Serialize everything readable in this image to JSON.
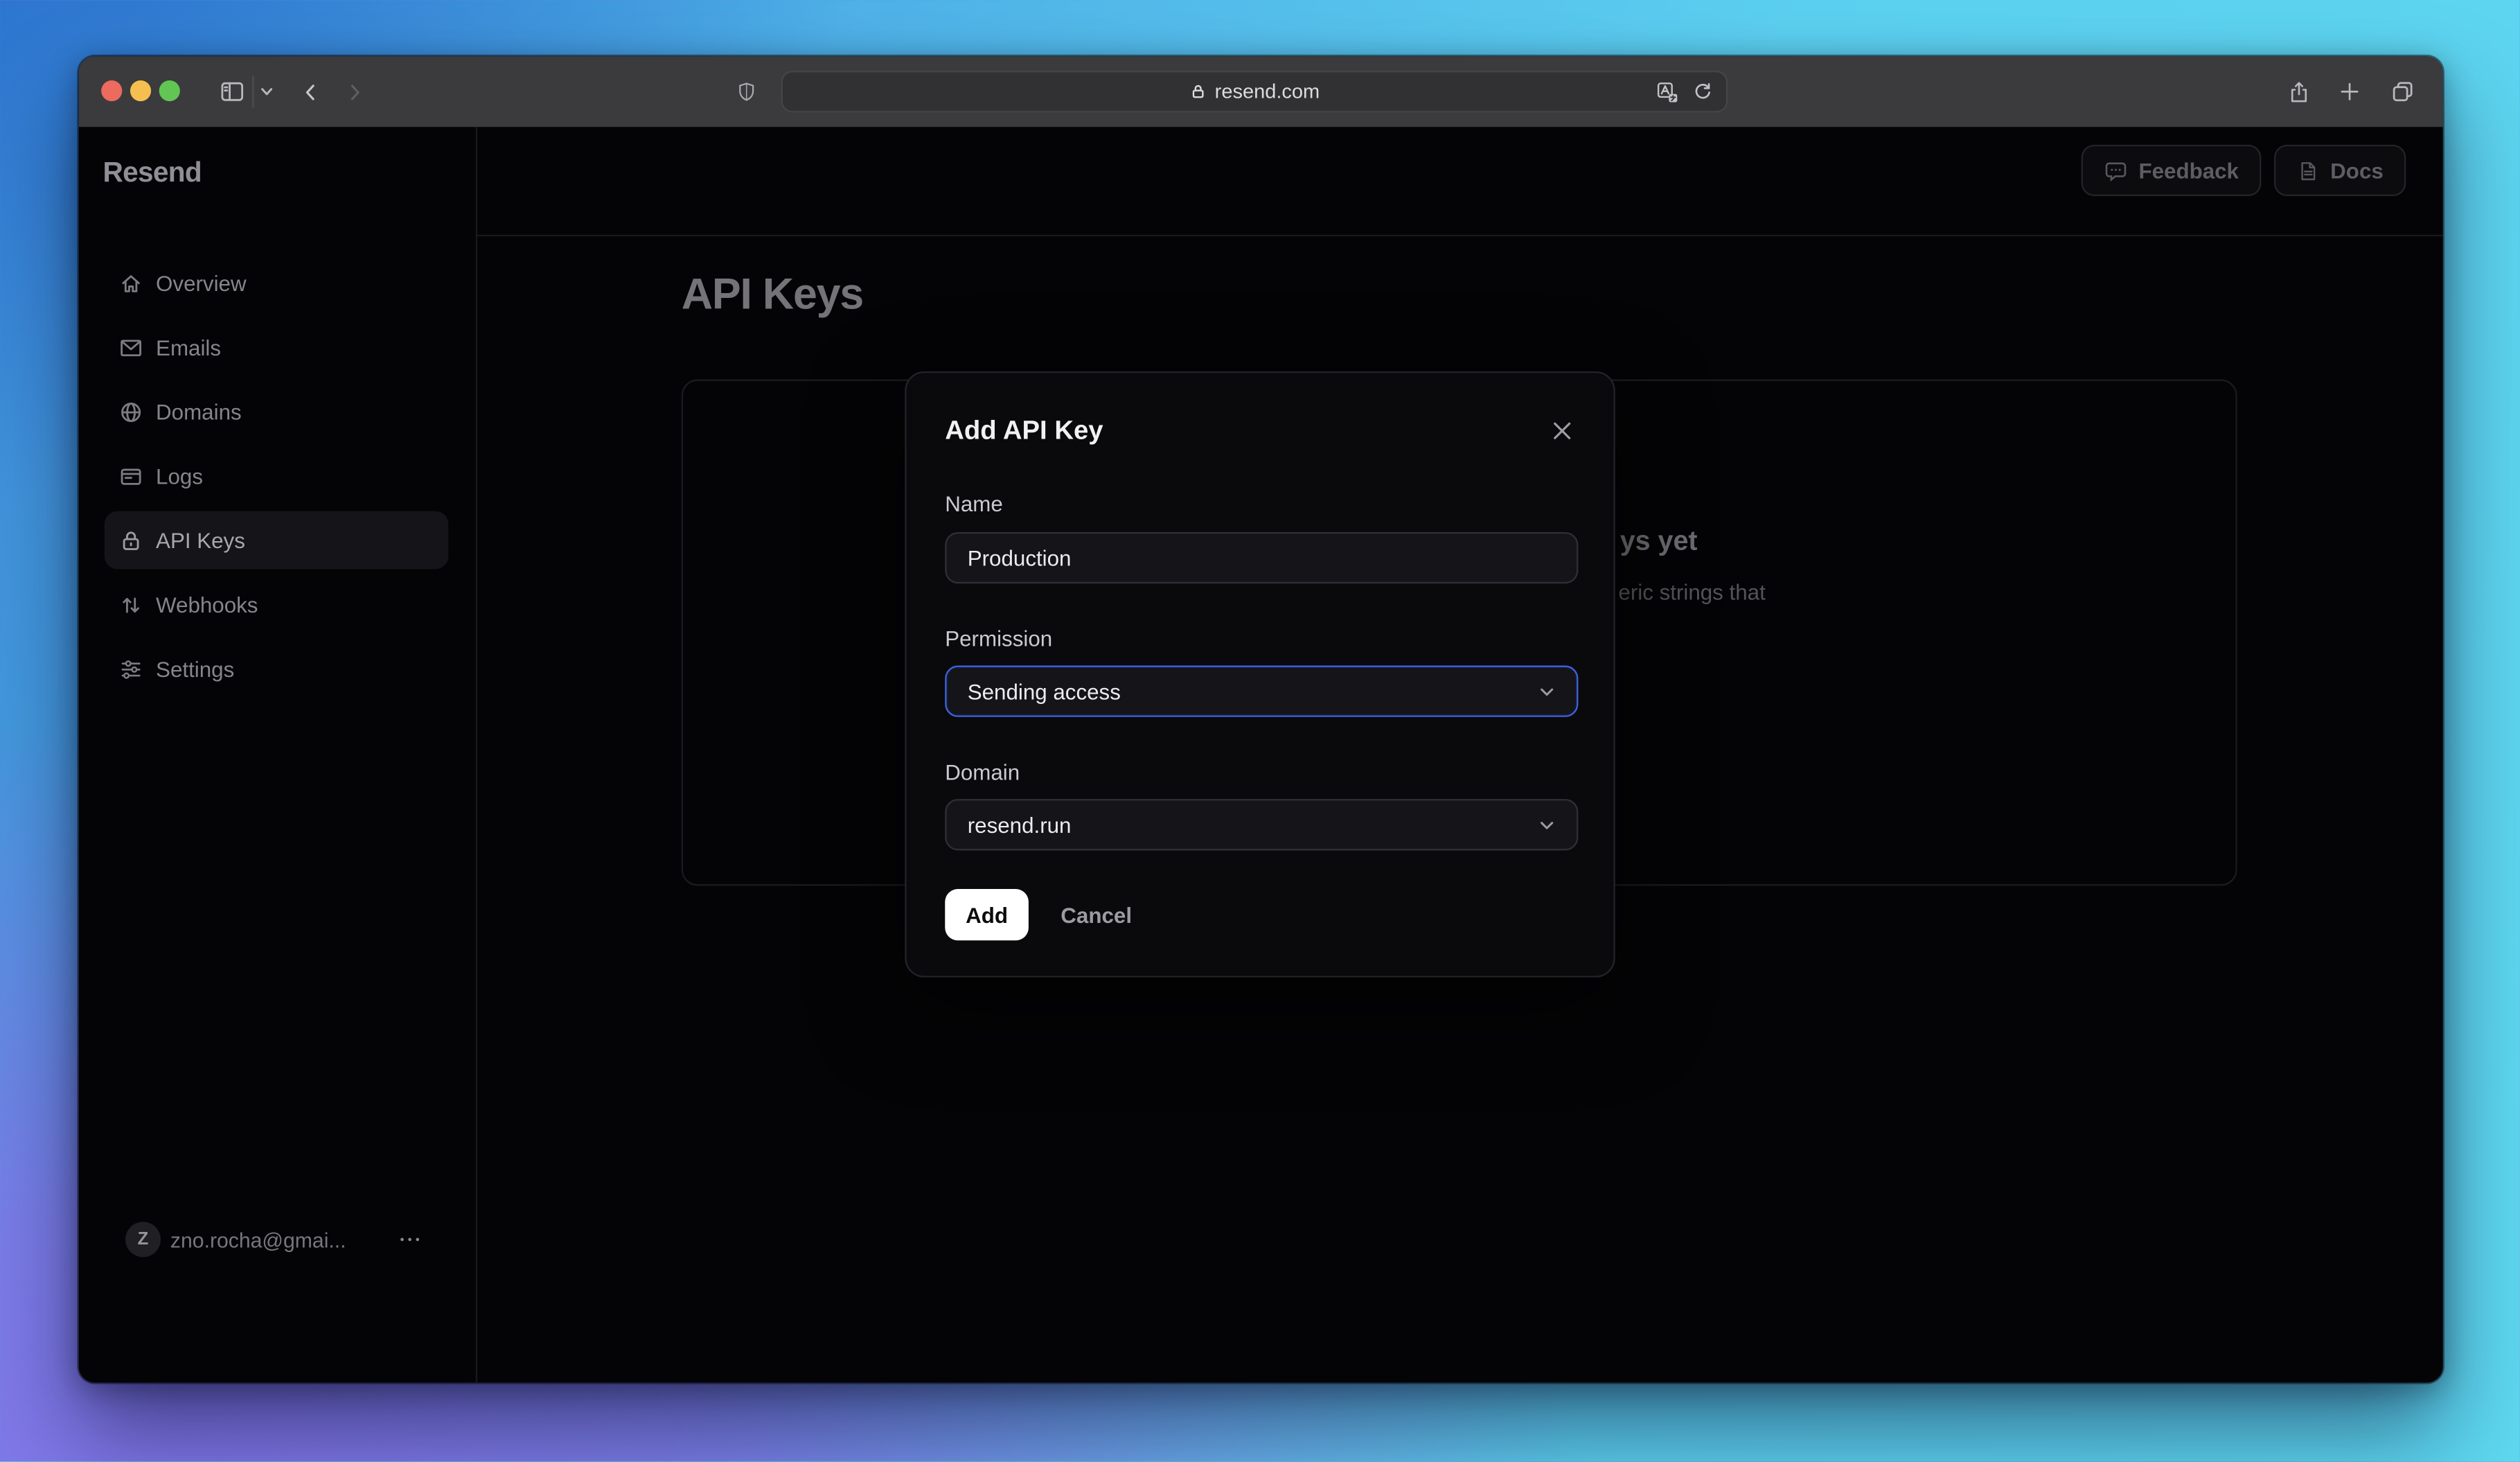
{
  "browser": {
    "url": "resend.com",
    "traffic_lights": {
      "close": "#ec6a5e",
      "minimize": "#f5bf4f",
      "zoom": "#61c654"
    },
    "toolbar_icons": [
      "sidebar-toggle-icon",
      "chevron-down-icon",
      "back-icon",
      "forward-icon",
      "shield-icon",
      "lock-icon",
      "translate-icon",
      "reload-icon",
      "share-icon",
      "new-tab-icon",
      "tabs-overview-icon"
    ]
  },
  "app": {
    "logo": "Resend",
    "sidebar": {
      "items": [
        {
          "label": "Overview",
          "icon": "home-icon",
          "active": false
        },
        {
          "label": "Emails",
          "icon": "mail-icon",
          "active": false
        },
        {
          "label": "Domains",
          "icon": "globe-icon",
          "active": false
        },
        {
          "label": "Logs",
          "icon": "logs-icon",
          "active": false
        },
        {
          "label": "API Keys",
          "icon": "lock-icon",
          "active": true
        },
        {
          "label": "Webhooks",
          "icon": "arrows-up-down-icon",
          "active": false
        },
        {
          "label": "Settings",
          "icon": "sliders-icon",
          "active": false
        }
      ],
      "user": {
        "initial": "Z",
        "email": "zno.rocha@gmai...",
        "menu_icon": "ellipsis-icon"
      }
    },
    "header": {
      "feedback_label": "Feedback",
      "docs_label": "Docs"
    },
    "main": {
      "title": "API Keys",
      "empty_card": {
        "title_fragment": "ys yet",
        "body_fragment": "eric strings that"
      }
    }
  },
  "modal": {
    "title": "Add API Key",
    "close_icon": "close-icon",
    "fields": [
      {
        "label": "Name",
        "type": "input",
        "value": "Production"
      },
      {
        "label": "Permission",
        "type": "select",
        "value": "Sending access",
        "focused": true
      },
      {
        "label": "Domain",
        "type": "select",
        "value": "resend.run",
        "focused": false
      }
    ],
    "add_label": "Add",
    "cancel_label": "Cancel"
  },
  "colors": {
    "accent_focus": "#3e63dd",
    "window_bg": "#050507",
    "toolbar_bg": "#3b3b3d",
    "modal_bg": "#0a0a0d",
    "field_bg": "#141419",
    "add_button_bg": "#ffffff",
    "desktop_gradient": [
      "#266ccc",
      "#4fb2e8",
      "#5ed8f0",
      "#8375e8"
    ]
  }
}
